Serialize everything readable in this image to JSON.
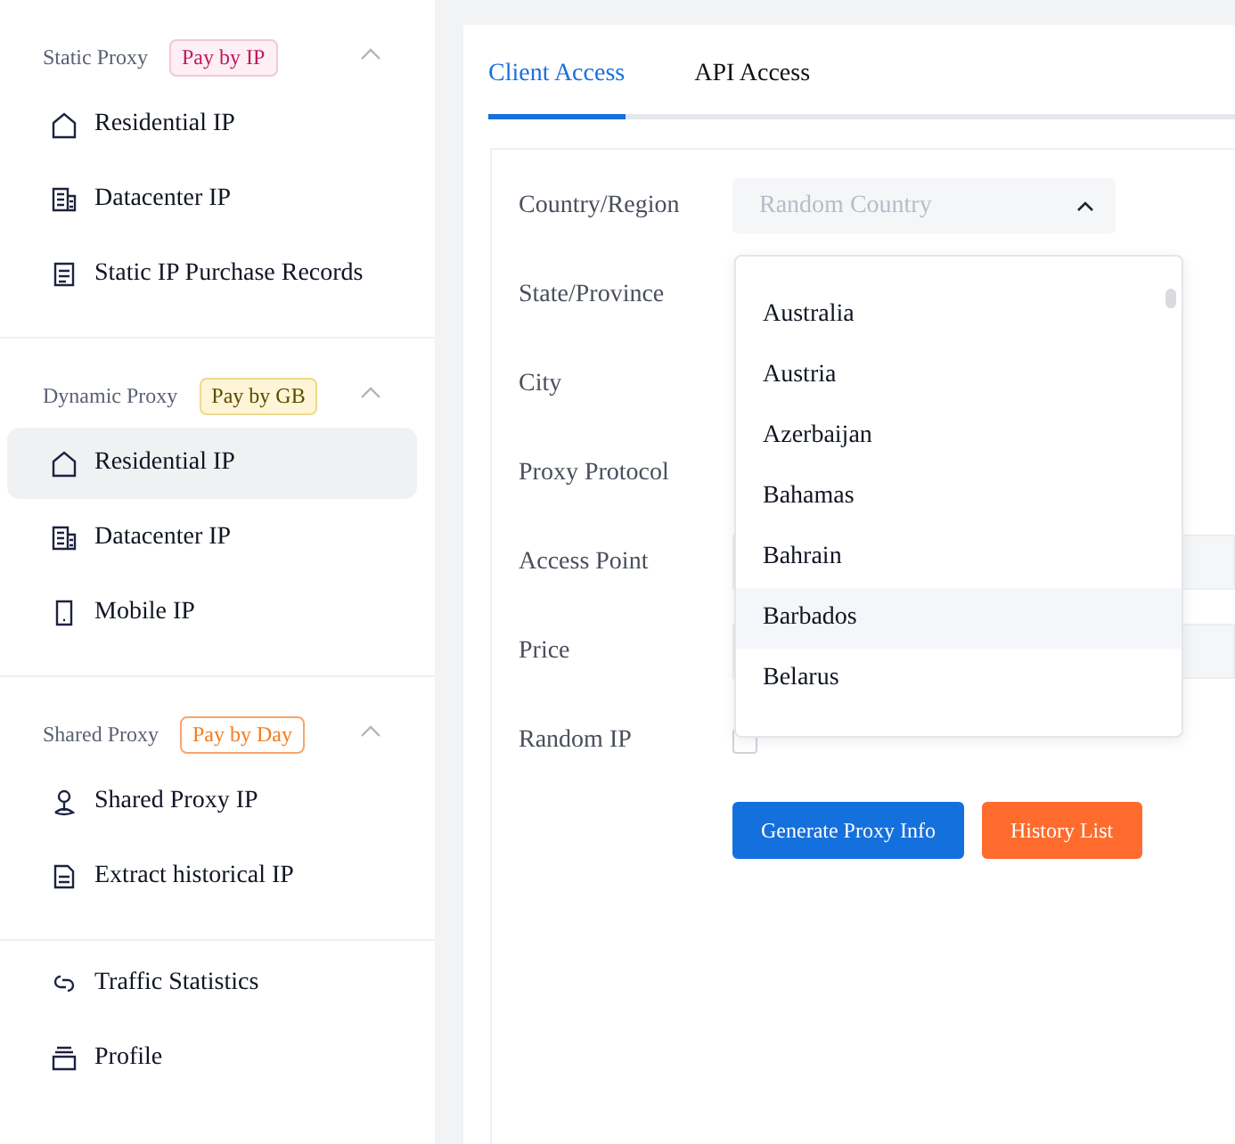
{
  "sidebar": {
    "sections": [
      {
        "title": "Static Proxy",
        "badge": {
          "text": "Pay by IP",
          "color": "#c2185b"
        },
        "expanded": true,
        "items": [
          {
            "label": "Residential IP",
            "selected": false
          },
          {
            "label": "Datacenter IP",
            "selected": false
          },
          {
            "label": "Static IP Purchase Records",
            "selected": false
          }
        ]
      },
      {
        "title": "Dynamic Proxy",
        "badge": {
          "text": "Pay by GB",
          "color": "#5c4a00"
        },
        "expanded": true,
        "items": [
          {
            "label": "Residential IP",
            "selected": true
          },
          {
            "label": "Datacenter IP",
            "selected": false
          },
          {
            "label": "Mobile IP",
            "selected": false
          }
        ]
      },
      {
        "title": "Shared Proxy",
        "badge": {
          "text": "Pay by Day",
          "color": "#f47b20"
        },
        "expanded": true,
        "items": [
          {
            "label": "Shared Proxy IP",
            "selected": false
          },
          {
            "label": "Extract historical IP",
            "selected": false
          }
        ]
      }
    ],
    "bottom_items": [
      {
        "label": "Traffic Statistics",
        "selected": false
      },
      {
        "label": "Profile",
        "selected": false
      }
    ]
  },
  "tabs": [
    {
      "label": "Client Access",
      "selected": true
    },
    {
      "label": "API Access",
      "selected": false
    }
  ],
  "form": {
    "rows": [
      {
        "label": "Country/Region",
        "kind": "select",
        "placeholder": "Random Country",
        "expanded": true
      },
      {
        "label": "State/Province",
        "kind": "label"
      },
      {
        "label": "City",
        "kind": "label"
      },
      {
        "label": "Proxy Protocol",
        "kind": "label"
      },
      {
        "label": "Access Point",
        "kind": "field"
      },
      {
        "label": "Price",
        "kind": "field"
      },
      {
        "label": "Random IP",
        "kind": "checkbox",
        "checked": false
      }
    ],
    "dropdown": {
      "options": [
        {
          "label": "Australia",
          "highlighted": false
        },
        {
          "label": "Austria",
          "highlighted": false
        },
        {
          "label": "Azerbaijan",
          "highlighted": false
        },
        {
          "label": "Bahamas",
          "highlighted": false
        },
        {
          "label": "Bahrain",
          "highlighted": false
        },
        {
          "label": "Barbados",
          "highlighted": true
        },
        {
          "label": "Belarus",
          "highlighted": false
        }
      ]
    },
    "buttons": [
      {
        "label": "Generate Proxy Info",
        "kind": "primary"
      },
      {
        "label": "History List",
        "kind": "secondary"
      }
    ]
  }
}
